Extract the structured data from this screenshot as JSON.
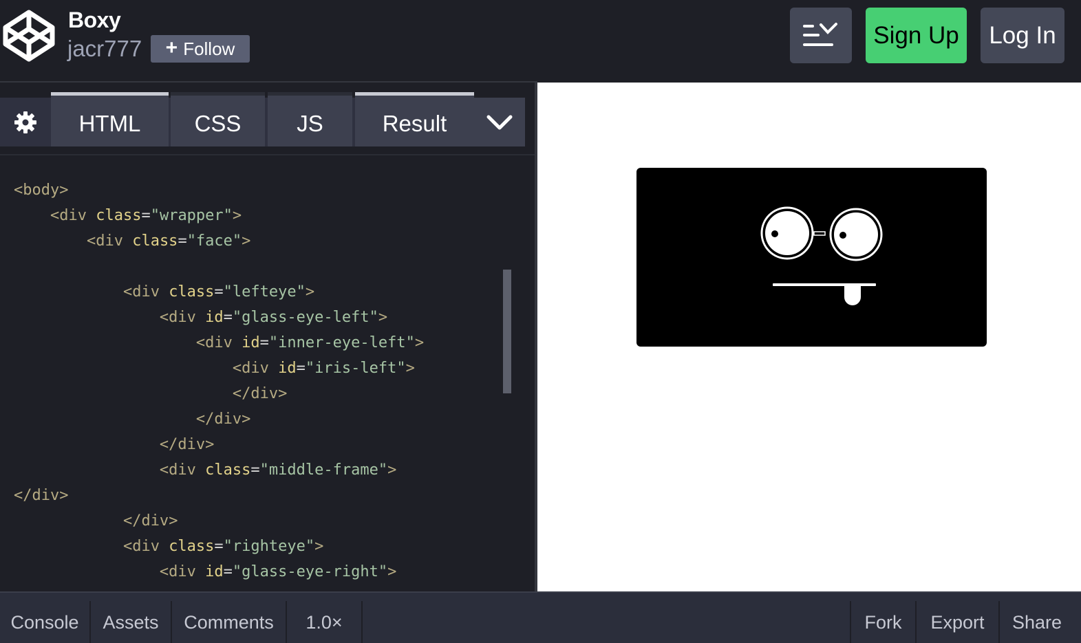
{
  "header": {
    "pen_title": "Boxy",
    "author": "jacr777",
    "follow_label": "Follow",
    "signup_label": "Sign Up",
    "login_label": "Log In",
    "icons": [
      "codepen-logo-icon",
      "plus-icon",
      "layout-toggle-icon"
    ]
  },
  "editor": {
    "tabs": {
      "html": "HTML",
      "css": "CSS",
      "js": "JS",
      "result": "Result"
    },
    "code_lines": [
      "<body>",
      "    <div class=\"wrapper\">",
      "        <div class=\"face\">",
      "",
      "            <div class=\"lefteye\">",
      "                <div id=\"glass-eye-left\">",
      "                    <div id=\"inner-eye-left\">",
      "                        <div id=\"iris-left\">",
      "                        </div>",
      "                    </div>",
      "                </div>",
      "                <div class=\"middle-frame\">",
      "</div>",
      "            </div>",
      "            <div class=\"righteye\">",
      "                <div id=\"glass-eye-right\">"
    ]
  },
  "footer": {
    "console": "Console",
    "assets": "Assets",
    "comments": "Comments",
    "zoom": "1.0×",
    "fork": "Fork",
    "export": "Export",
    "share": "Share"
  }
}
